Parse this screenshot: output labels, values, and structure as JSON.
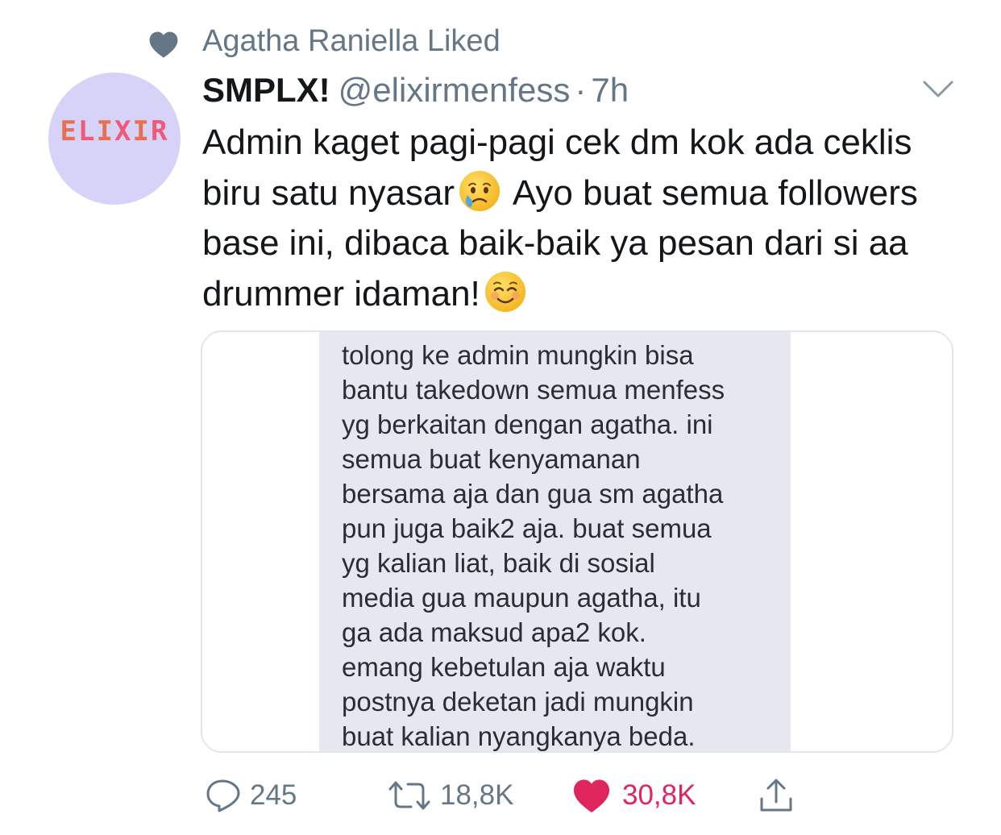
{
  "context": {
    "icon": "heart-icon",
    "text": "Agatha Raniella Liked"
  },
  "author": {
    "avatar_text": "ELIXIR",
    "display_name": "SMPLX!",
    "handle": "@elixirmenfess",
    "separator": "·",
    "time": "7h"
  },
  "tweet": {
    "text_part1": "Admin kaget pagi-pagi cek dm kok ada ceklis biru satu nyasar",
    "emoji1": "crying-face-emoji",
    "text_part2": " Ayo buat semua followers base ini, dibaca baik-baik ya pesan dari si aa drummer idaman!",
    "emoji2": "smiling-face-emoji"
  },
  "media": {
    "dm_text": "tolong ke admin mungkin bisa\nbantu takedown semua menfess\nyg berkaitan dengan agatha. ini\nsemua buat kenyamanan\nbersama aja dan gua sm agatha\npun juga baik2 aja. buat semua\nyg kalian liat, baik di sosial\nmedia gua maupun agatha, itu\nga ada maksud apa2 kok.\nemang kebetulan aja waktu\npostnya deketan jadi mungkin\nbuat kalian nyangkanya beda."
  },
  "actions": {
    "reply_count": "245",
    "retweet_count": "18,8K",
    "like_count": "30,8K",
    "liked": true
  },
  "colors": {
    "secondary_text": "#657786",
    "like_red": "#e0245e",
    "avatar_bg": "#d7d2f7",
    "dm_bubble_bg": "#e7e7f1"
  }
}
